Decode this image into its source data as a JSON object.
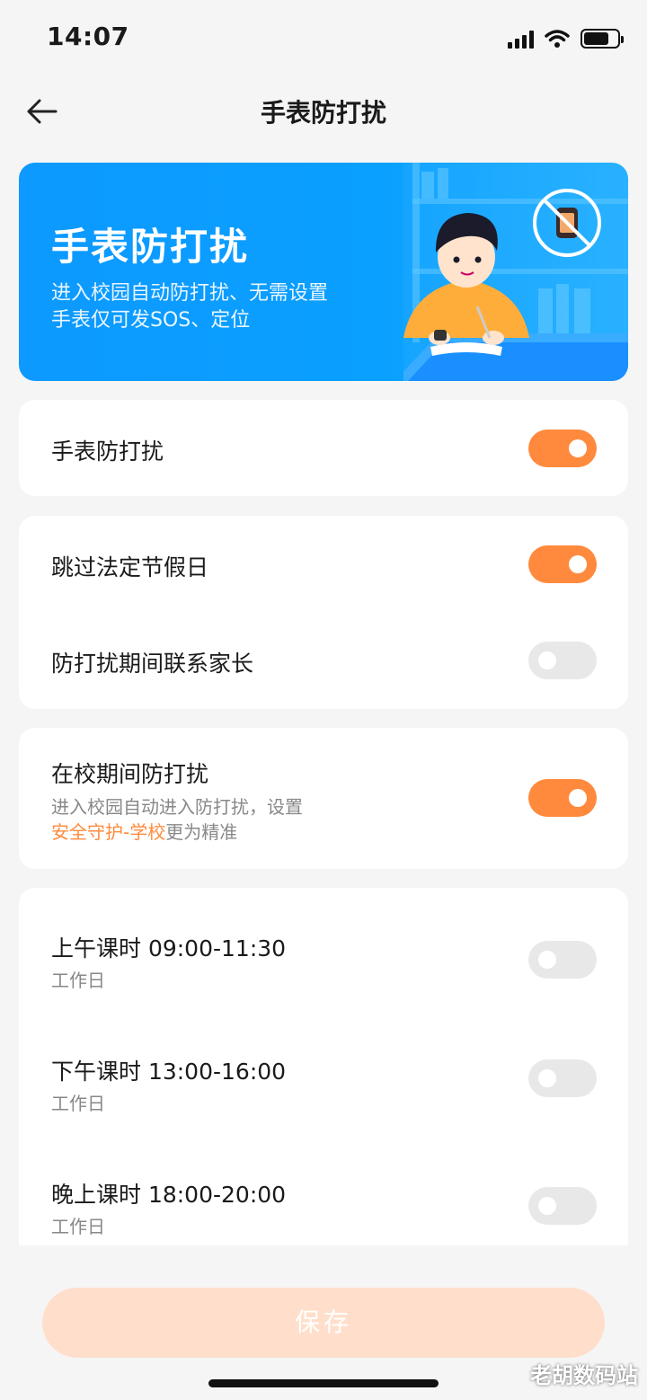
{
  "status_bar": {
    "time": "14:07"
  },
  "header": {
    "title": "手表防打扰"
  },
  "banner": {
    "title": "手表防打扰",
    "line1": "进入校园自动防打扰、无需设置",
    "line2": "手表仅可发SOS、定位"
  },
  "settings": {
    "watch_dnd": {
      "label": "手表防打扰",
      "enabled": true
    },
    "skip_holidays": {
      "label": "跳过法定节假日",
      "enabled": true
    },
    "contact_parents": {
      "label": "防打扰期间联系家长",
      "enabled": false
    },
    "school_dnd": {
      "label": "在校期间防打扰",
      "desc_line1": "进入校园自动进入防打扰，设置",
      "desc_link": "安全守护-学校",
      "desc_tail": "更为精准",
      "enabled": true
    },
    "periods": [
      {
        "label": "上午课时 09:00-11:30",
        "sub": "工作日",
        "enabled": false
      },
      {
        "label": "下午课时 13:00-16:00",
        "sub": "工作日",
        "enabled": false
      },
      {
        "label": "晚上课时 18:00-20:00",
        "sub": "工作日",
        "enabled": false
      }
    ]
  },
  "footer": {
    "save_label": "保存"
  },
  "watermark": "老胡数码站",
  "colors": {
    "accent": "#ff8a3d",
    "banner_blue": "#0d99ff",
    "toggle_off": "#e8e8e8",
    "save_disabled": "#ffdfcc"
  }
}
